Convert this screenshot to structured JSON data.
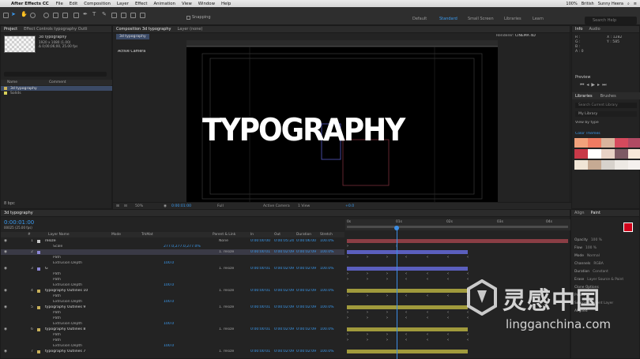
{
  "menubar": {
    "app": "After Effects CC",
    "items": [
      "File",
      "Edit",
      "Composition",
      "Layer",
      "Effect",
      "Animation",
      "View",
      "Window",
      "Help"
    ],
    "right": [
      "100%",
      "British",
      "Sunny Heera"
    ]
  },
  "toolbar": {
    "snapping": "Snapping",
    "workspaces": [
      "Default",
      "Standard",
      "Small Screen",
      "Libraries",
      "Learn"
    ],
    "active_workspace": "Standard",
    "search_placeholder": "Search Help"
  },
  "project": {
    "tab": "Project",
    "tab2": "Effect Controls typography Outli",
    "item_name": "3d typography",
    "item_info1": "1920 x 1080 (1.00)",
    "item_info2": "Δ 0;00;06;00, 25.00 fps",
    "col_name": "Name",
    "col_comment": "Comment",
    "rows": [
      {
        "name": "3d typography",
        "color": "#c9b15a"
      },
      {
        "name": "Solids",
        "color": "#d8d058"
      }
    ]
  },
  "viewer": {
    "tab": "Composition 3d typography",
    "tab2": "Layer (none)",
    "crumb": "3d typography",
    "renderer_label": "Renderer:",
    "renderer": "CINEMA 4D",
    "camera": "Active Camera",
    "artwork": "TYPOGRAPHY",
    "controls": {
      "zoom": "50%",
      "time": "0:00:01:00",
      "resolution": "Full",
      "view_camera": "Active Camera",
      "views": "1 View",
      "exposure": "+0.0"
    }
  },
  "info": {
    "tab": "Info",
    "tab2": "Audio",
    "r": "R :",
    "g": "G :",
    "b": "B :",
    "a": "A : 0",
    "x": "X : 1282",
    "y": "Y : 585"
  },
  "preview": {
    "tab": "Preview"
  },
  "libraries": {
    "tab": "Libraries",
    "tab2": "Brushes",
    "search": "Search Current Library",
    "library": "My Library",
    "view": "View by type",
    "section": "Color Themes",
    "swatches": [
      "#f2a27c",
      "#ef7b62",
      "#d9b49d",
      "#d64a5d",
      "#b04a63",
      "#c83948",
      "#ffffff",
      "#e8d2c6",
      "#7d5a64",
      "#f8e8d9",
      "#f0e5d6",
      "#c6aa93",
      "#d7d2cc",
      "#ede9e4",
      "#f5f1ee"
    ]
  },
  "timeline": {
    "tab": "3d typography",
    "time": "0:00:01:00",
    "frames": "00025 (25.00 fps)",
    "columns": [
      "#",
      "Layer Name",
      "Mode",
      "TrkMat",
      "Parent & Link",
      "In",
      "Out",
      "Duration",
      "Stretch"
    ],
    "rows": [
      {
        "num": "1",
        "name": "resize",
        "in": "0:00:00:00",
        "out": "0:00:05:24",
        "dur": "0:00:06:00",
        "stretch": "100.0%",
        "parent": "None"
      },
      {
        "num": "",
        "name": "Scale",
        "value": "277.0,277.0,277.0%"
      },
      {
        "num": "2",
        "name": "",
        "in": "0:00:00:01",
        "out": "0:00:02:09",
        "dur": "0:00:02:09",
        "stretch": "100.0%",
        "parent": "1. resize",
        "sel": true
      },
      {
        "num": "",
        "name": "Path"
      },
      {
        "num": "",
        "name": "Extrusion Depth",
        "value": "100.0"
      },
      {
        "num": "3",
        "name": "G",
        "in": "0:00:00:01",
        "out": "0:00:02:09",
        "dur": "0:00:02:09",
        "stretch": "100.0%",
        "parent": "1. resize"
      },
      {
        "num": "",
        "name": "Path"
      },
      {
        "num": "",
        "name": "Path"
      },
      {
        "num": "",
        "name": "Extrusion Depth",
        "value": "100.0"
      },
      {
        "num": "4",
        "name": "typography Outlines 10",
        "in": "0:00:00:01",
        "out": "0:00:02:09",
        "dur": "0:00:02:09",
        "stretch": "100.0%",
        "parent": "1. resize"
      },
      {
        "num": "",
        "name": "Path"
      },
      {
        "num": "",
        "name": "Extrusion Depth",
        "value": "100.0"
      },
      {
        "num": "5",
        "name": "typography Outlines 9",
        "in": "0:00:00:01",
        "out": "0:00:02:09",
        "dur": "0:00:02:09",
        "stretch": "100.0%",
        "parent": "1. resize"
      },
      {
        "num": "",
        "name": "Path"
      },
      {
        "num": "",
        "name": "Path"
      },
      {
        "num": "",
        "name": "Extrusion Depth",
        "value": "100.0"
      },
      {
        "num": "6",
        "name": "typography Outlines 8",
        "in": "0:00:00:01",
        "out": "0:00:02:09",
        "dur": "0:00:02:09",
        "stretch": "100.0%",
        "parent": "1. resize"
      },
      {
        "num": "",
        "name": "Path"
      },
      {
        "num": "",
        "name": "Path"
      },
      {
        "num": "",
        "name": "Extrusion Depth",
        "value": "100.0"
      },
      {
        "num": "7",
        "name": "typography Outlines 7",
        "in": "0:00:00:01",
        "out": "0:00:02:09",
        "dur": "0:00:02:09",
        "stretch": "100.0%",
        "parent": "1. resize"
      }
    ],
    "ruler": [
      "0s",
      "01s",
      "02s",
      "03s",
      "04s"
    ]
  },
  "align": {
    "tab": "Align",
    "tab2": "Paint",
    "fields": [
      "Opacity",
      "Flow",
      "Mode",
      "Channels",
      "Duration",
      "Erase",
      "Clone Options",
      "Preset",
      "Source",
      "Aligned"
    ],
    "values": [
      "100 %",
      "100 %",
      "Normal",
      "RGBA",
      "Constant",
      "Layer Source & Paint",
      "",
      "",
      "Current Layer",
      ""
    ]
  },
  "watermark": {
    "cn": "灵感中国",
    "en": "lingganchina.com"
  }
}
